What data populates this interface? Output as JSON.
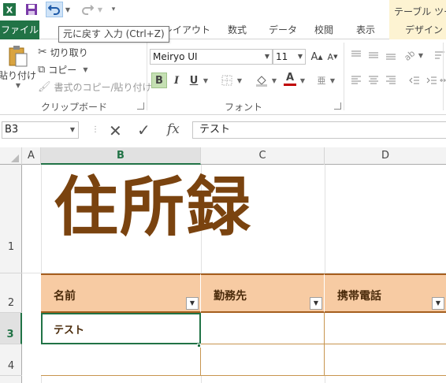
{
  "qat": {
    "app_icon": "excel-icon",
    "redo_icon": "redo-icon"
  },
  "contextual_group_title": "テーブル ツール",
  "tabs": {
    "file": "ファイル",
    "page_layout": "レイアウト",
    "formulas": "数式",
    "data": "データ",
    "review": "校閲",
    "view": "表示",
    "design": "デザイン"
  },
  "tooltip": "元に戻す 入力 (Ctrl+Z)",
  "ribbon": {
    "clipboard": {
      "paste": "貼り付け",
      "cut": "切り取り",
      "copy": "コピー",
      "format_painter": "書式のコピー/貼り付け",
      "group_label": "クリップボード"
    },
    "font": {
      "font_name": "Meiryo UI",
      "font_size": "11",
      "bold": "B",
      "italic": "I",
      "underline": "U",
      "group_label": "フォント",
      "font_color": "#c00000"
    }
  },
  "formula_bar": {
    "name_box": "B3",
    "cancel_symbol": "✕",
    "enter_symbol": "✓",
    "fx_symbol": "fx",
    "content": "テスト"
  },
  "grid": {
    "columns": [
      "A",
      "B",
      "C",
      "D"
    ],
    "rows": [
      "1",
      "2",
      "3",
      "4"
    ],
    "title": "住所録",
    "table_headers": [
      "名前",
      "勤務先",
      "携帯電話"
    ],
    "table_rows": [
      [
        "テスト",
        "",
        ""
      ],
      [
        "",
        "",
        ""
      ]
    ]
  },
  "colors": {
    "excel_green": "#217346",
    "title_brown": "#7a430f",
    "header_fill": "#f7cba3",
    "header_border": "#a55e1e"
  }
}
